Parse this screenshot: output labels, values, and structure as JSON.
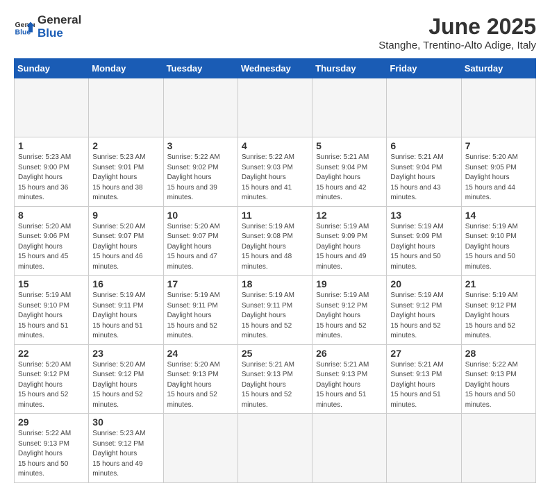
{
  "header": {
    "logo_general": "General",
    "logo_blue": "Blue",
    "title": "June 2025",
    "subtitle": "Stanghe, Trentino-Alto Adige, Italy"
  },
  "calendar": {
    "days_of_week": [
      "Sunday",
      "Monday",
      "Tuesday",
      "Wednesday",
      "Thursday",
      "Friday",
      "Saturday"
    ],
    "weeks": [
      [
        {
          "day": "",
          "empty": true
        },
        {
          "day": "",
          "empty": true
        },
        {
          "day": "",
          "empty": true
        },
        {
          "day": "",
          "empty": true
        },
        {
          "day": "",
          "empty": true
        },
        {
          "day": "",
          "empty": true
        },
        {
          "day": "",
          "empty": true
        }
      ],
      [
        {
          "day": "1",
          "sunrise": "5:23 AM",
          "sunset": "9:00 PM",
          "daylight": "15 hours and 36 minutes."
        },
        {
          "day": "2",
          "sunrise": "5:23 AM",
          "sunset": "9:01 PM",
          "daylight": "15 hours and 38 minutes."
        },
        {
          "day": "3",
          "sunrise": "5:22 AM",
          "sunset": "9:02 PM",
          "daylight": "15 hours and 39 minutes."
        },
        {
          "day": "4",
          "sunrise": "5:22 AM",
          "sunset": "9:03 PM",
          "daylight": "15 hours and 41 minutes."
        },
        {
          "day": "5",
          "sunrise": "5:21 AM",
          "sunset": "9:04 PM",
          "daylight": "15 hours and 42 minutes."
        },
        {
          "day": "6",
          "sunrise": "5:21 AM",
          "sunset": "9:04 PM",
          "daylight": "15 hours and 43 minutes."
        },
        {
          "day": "7",
          "sunrise": "5:20 AM",
          "sunset": "9:05 PM",
          "daylight": "15 hours and 44 minutes."
        }
      ],
      [
        {
          "day": "8",
          "sunrise": "5:20 AM",
          "sunset": "9:06 PM",
          "daylight": "15 hours and 45 minutes."
        },
        {
          "day": "9",
          "sunrise": "5:20 AM",
          "sunset": "9:07 PM",
          "daylight": "15 hours and 46 minutes."
        },
        {
          "day": "10",
          "sunrise": "5:20 AM",
          "sunset": "9:07 PM",
          "daylight": "15 hours and 47 minutes."
        },
        {
          "day": "11",
          "sunrise": "5:19 AM",
          "sunset": "9:08 PM",
          "daylight": "15 hours and 48 minutes."
        },
        {
          "day": "12",
          "sunrise": "5:19 AM",
          "sunset": "9:09 PM",
          "daylight": "15 hours and 49 minutes."
        },
        {
          "day": "13",
          "sunrise": "5:19 AM",
          "sunset": "9:09 PM",
          "daylight": "15 hours and 50 minutes."
        },
        {
          "day": "14",
          "sunrise": "5:19 AM",
          "sunset": "9:10 PM",
          "daylight": "15 hours and 50 minutes."
        }
      ],
      [
        {
          "day": "15",
          "sunrise": "5:19 AM",
          "sunset": "9:10 PM",
          "daylight": "15 hours and 51 minutes."
        },
        {
          "day": "16",
          "sunrise": "5:19 AM",
          "sunset": "9:11 PM",
          "daylight": "15 hours and 51 minutes."
        },
        {
          "day": "17",
          "sunrise": "5:19 AM",
          "sunset": "9:11 PM",
          "daylight": "15 hours and 52 minutes."
        },
        {
          "day": "18",
          "sunrise": "5:19 AM",
          "sunset": "9:11 PM",
          "daylight": "15 hours and 52 minutes."
        },
        {
          "day": "19",
          "sunrise": "5:19 AM",
          "sunset": "9:12 PM",
          "daylight": "15 hours and 52 minutes."
        },
        {
          "day": "20",
          "sunrise": "5:19 AM",
          "sunset": "9:12 PM",
          "daylight": "15 hours and 52 minutes."
        },
        {
          "day": "21",
          "sunrise": "5:19 AM",
          "sunset": "9:12 PM",
          "daylight": "15 hours and 52 minutes."
        }
      ],
      [
        {
          "day": "22",
          "sunrise": "5:20 AM",
          "sunset": "9:12 PM",
          "daylight": "15 hours and 52 minutes."
        },
        {
          "day": "23",
          "sunrise": "5:20 AM",
          "sunset": "9:12 PM",
          "daylight": "15 hours and 52 minutes."
        },
        {
          "day": "24",
          "sunrise": "5:20 AM",
          "sunset": "9:13 PM",
          "daylight": "15 hours and 52 minutes."
        },
        {
          "day": "25",
          "sunrise": "5:21 AM",
          "sunset": "9:13 PM",
          "daylight": "15 hours and 52 minutes."
        },
        {
          "day": "26",
          "sunrise": "5:21 AM",
          "sunset": "9:13 PM",
          "daylight": "15 hours and 51 minutes."
        },
        {
          "day": "27",
          "sunrise": "5:21 AM",
          "sunset": "9:13 PM",
          "daylight": "15 hours and 51 minutes."
        },
        {
          "day": "28",
          "sunrise": "5:22 AM",
          "sunset": "9:13 PM",
          "daylight": "15 hours and 50 minutes."
        }
      ],
      [
        {
          "day": "29",
          "sunrise": "5:22 AM",
          "sunset": "9:13 PM",
          "daylight": "15 hours and 50 minutes."
        },
        {
          "day": "30",
          "sunrise": "5:23 AM",
          "sunset": "9:12 PM",
          "daylight": "15 hours and 49 minutes."
        },
        {
          "day": "",
          "empty": true
        },
        {
          "day": "",
          "empty": true
        },
        {
          "day": "",
          "empty": true
        },
        {
          "day": "",
          "empty": true
        },
        {
          "day": "",
          "empty": true
        }
      ]
    ]
  }
}
